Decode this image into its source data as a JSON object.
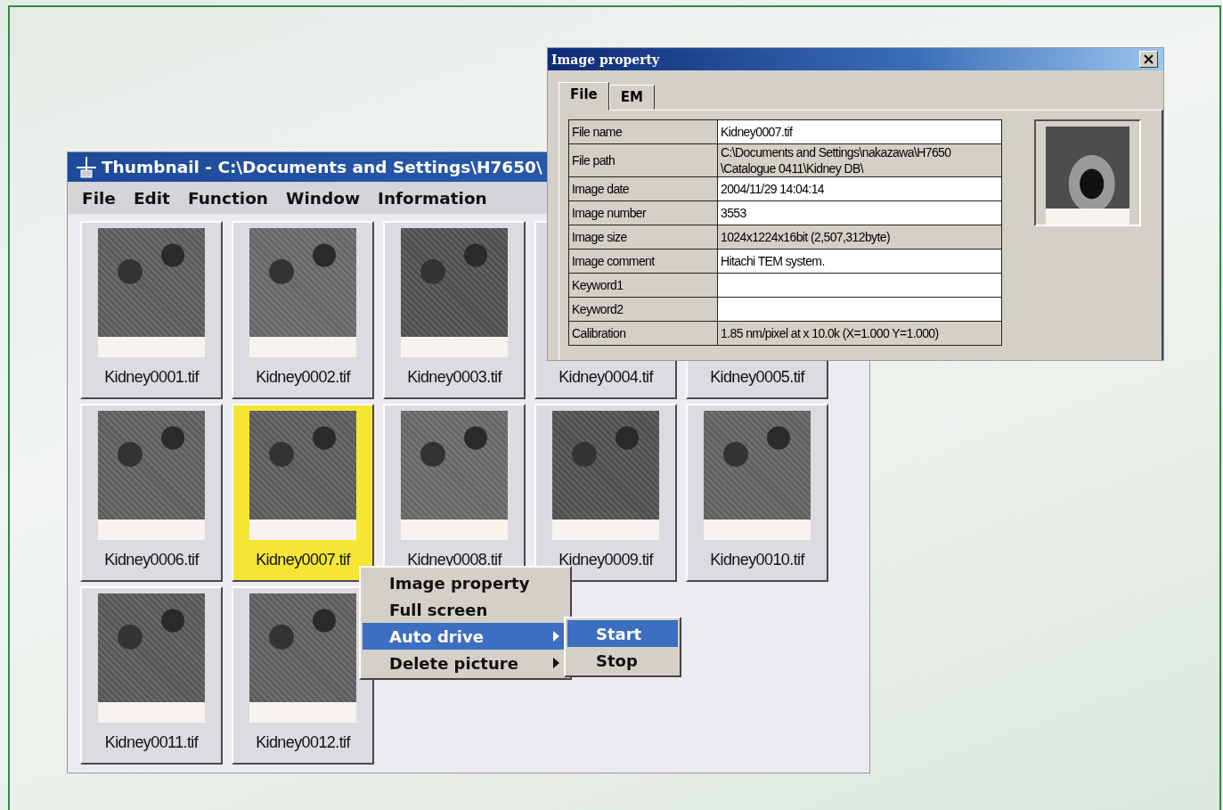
{
  "thumbnail_window": {
    "title": "Thumbnail - C:\\Documents and Settings\\H7650\\",
    "menu": [
      "File",
      "Edit",
      "Function",
      "Window",
      "Information"
    ],
    "thumbnails": [
      {
        "label": "Kidney0001.tif",
        "selected": false
      },
      {
        "label": "Kidney0002.tif",
        "selected": false
      },
      {
        "label": "Kidney0003.tif",
        "selected": false
      },
      {
        "label": "Kidney0004.tif",
        "selected": false
      },
      {
        "label": "Kidney0005.tif",
        "selected": false
      },
      {
        "label": "Kidney0006.tif",
        "selected": false
      },
      {
        "label": "Kidney0007.tif",
        "selected": true
      },
      {
        "label": "Kidney0008.tif",
        "selected": false
      },
      {
        "label": "Kidney0009.tif",
        "selected": false
      },
      {
        "label": "Kidney0010.tif",
        "selected": false
      },
      {
        "label": "Kidney0011.tif",
        "selected": false
      },
      {
        "label": "Kidney0012.tif",
        "selected": false
      }
    ]
  },
  "property_window": {
    "title": "Image property",
    "tabs": [
      {
        "label": "File",
        "selected": true
      },
      {
        "label": "EM",
        "selected": false
      }
    ],
    "rows": [
      {
        "label": "File name",
        "value": "Kidney0007.tif",
        "editable": true
      },
      {
        "label": "File path",
        "value": "C:\\Documents and Settings\\nakazawa\\H7650\n\\Catalogue 0411\\Kidney DB\\",
        "editable": false
      },
      {
        "label": "Image date",
        "value": "2004/11/29 14:04:14",
        "editable": true
      },
      {
        "label": "Image number",
        "value": "3553",
        "editable": true
      },
      {
        "label": "Image size",
        "value": "1024x1224x16bit (2,507,312byte)",
        "editable": false
      },
      {
        "label": "Image comment",
        "value": "Hitachi TEM system.",
        "editable": true
      },
      {
        "label": "Keyword1",
        "editable": true
      },
      {
        "label": "Keyword2",
        "editable": true
      },
      {
        "label": "Calibration",
        "value": "1.85 nm/pixel at x 10.0k (X=1.000 Y=1.000)",
        "editable": false
      }
    ]
  },
  "context_menu": {
    "items": [
      {
        "label": "Image property",
        "selected": false,
        "submenu": false
      },
      {
        "label": "Full screen",
        "selected": false,
        "submenu": false
      },
      {
        "label": "Auto drive",
        "selected": true,
        "submenu": true
      },
      {
        "label": "Delete picture",
        "selected": false,
        "submenu": true
      }
    ],
    "submenu": {
      "items": [
        {
          "label": "Start",
          "selected": true
        },
        {
          "label": "Stop",
          "selected": false
        }
      ]
    }
  }
}
